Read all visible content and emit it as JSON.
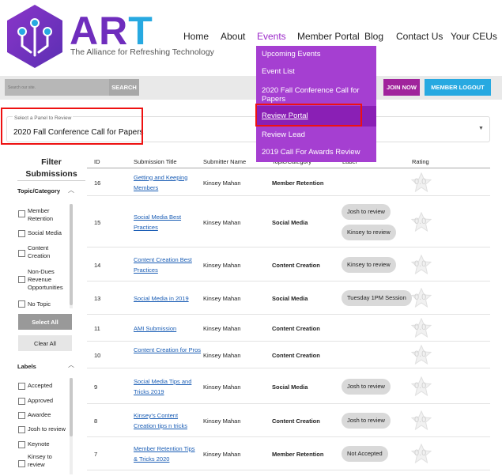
{
  "brand": {
    "name_part1": "AR",
    "name_part2": "T",
    "tagline": "The Alliance for Refreshing Technology",
    "colors": {
      "purple": "#6f2dbd",
      "blue": "#27a9e1",
      "menu": "#a53fd1"
    }
  },
  "nav": {
    "items": [
      {
        "label": "Home"
      },
      {
        "label": "About"
      },
      {
        "label": "Events"
      },
      {
        "label": "Member Portal"
      },
      {
        "label": "Blog"
      },
      {
        "label": "Contact Us"
      },
      {
        "label": "Your CEUs"
      }
    ]
  },
  "events_menu": [
    {
      "label": "Upcoming Events"
    },
    {
      "label": "Event List"
    },
    {
      "label": "2020 Fall Conference Call for Papers"
    },
    {
      "label": "Review Portal"
    },
    {
      "label": "Review Lead"
    },
    {
      "label": "2019 Call For Awards Review"
    }
  ],
  "searchbar": {
    "placeholder": "Search our site.",
    "search_label": "SEARCH",
    "join_label": "JOIN NOW",
    "logout_label": "MEMBER LOGOUT"
  },
  "panel": {
    "label": "Select a Panel to Review",
    "value": "2020 Fall Conference Call for Papers"
  },
  "sidebar": {
    "title_line1": "Filter",
    "title_line2": "Submissions",
    "topic_title": "Topic/Category",
    "topics": [
      {
        "label": "Member Retention"
      },
      {
        "label": "Social Media"
      },
      {
        "label": "Content Creation"
      },
      {
        "label": "Non-Dues Revenue Opportunities"
      },
      {
        "label": "No Topic"
      }
    ],
    "select_all": "Select All",
    "clear_all": "Clear All",
    "labels_title": "Labels",
    "labels": [
      {
        "label": "Accepted"
      },
      {
        "label": "Approved"
      },
      {
        "label": "Awardee"
      },
      {
        "label": "Josh to review"
      },
      {
        "label": "Keynote"
      },
      {
        "label": "Kinsey to review"
      }
    ]
  },
  "table": {
    "headers": {
      "id": "ID",
      "title": "Submission Title",
      "submitter": "Submitter Name",
      "topic": "Topic/Category",
      "label": "Label",
      "rating": "Rating"
    },
    "rows": [
      {
        "id": "16",
        "title": "Getting and Keeping Members",
        "submitter": "Kinsey Mahan",
        "topic": "Member Retention",
        "tags": [],
        "rating": "0.0"
      },
      {
        "id": "15",
        "title": "Social Media Best Practices",
        "submitter": "Kinsey Mahan",
        "topic": "Social Media",
        "tags": [
          "Josh to review",
          "Kinsey to review"
        ],
        "rating": "0.0"
      },
      {
        "id": "14",
        "title": "Content Creation Best Practices",
        "submitter": "Kinsey Mahan",
        "topic": "Content Creation",
        "tags": [
          "Kinsey to review"
        ],
        "rating": "0.0"
      },
      {
        "id": "13",
        "title": "Social Media in 2019",
        "submitter": "Kinsey Mahan",
        "topic": "Social Media",
        "tags": [
          "Tuesday 1PM Session"
        ],
        "rating": "0.0"
      },
      {
        "id": "11",
        "title": "AMI Submission",
        "submitter": "Kinsey Mahan",
        "topic": "Content Creation",
        "tags": [],
        "rating": "0.0"
      },
      {
        "id": "10",
        "title": "Content Creation for Pros",
        "submitter": "Kinsey Mahan",
        "topic": "Content Creation",
        "tags": [],
        "rating": "0.0"
      },
      {
        "id": "9",
        "title": "Social Media Tips and Tricks 2019",
        "submitter": "Kinsey Mahan",
        "topic": "Social Media",
        "tags": [
          "Josh to review"
        ],
        "rating": "0.0"
      },
      {
        "id": "8",
        "title": "Kinsey's Content Creation tips n tricks",
        "submitter": "Kinsey Mahan",
        "topic": "Content Creation",
        "tags": [
          "Josh to review"
        ],
        "rating": "0.0"
      },
      {
        "id": "7",
        "title": "Member Retention Tips & Tricks 2020",
        "submitter": "Kinsey Mahan",
        "topic": "Member Retention",
        "tags": [
          "Not Accepted"
        ],
        "rating": "0.0"
      }
    ]
  }
}
